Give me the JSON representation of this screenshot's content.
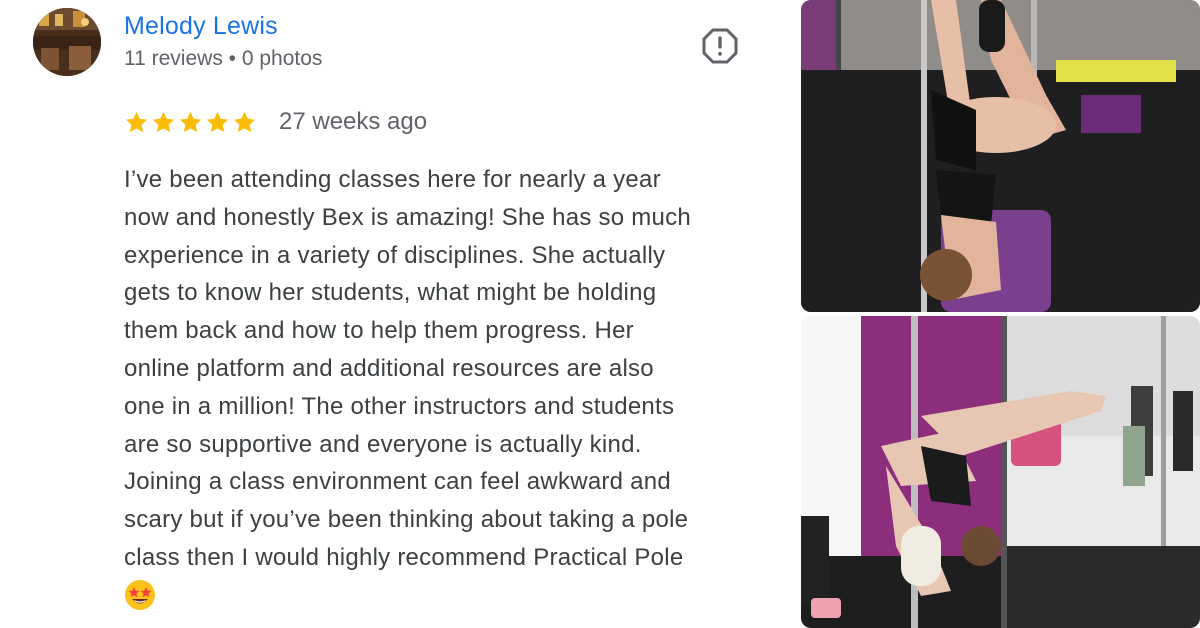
{
  "reviewer": {
    "name": "Melody Lewis",
    "meta": "11 reviews • 0 photos",
    "avatar_icon": "reviewer-avatar"
  },
  "review": {
    "rating": 5,
    "rating_max": 5,
    "time_ago": "27 weeks ago",
    "lines": [
      "I’ve been attending classes here for nearly a year",
      "now and honestly Bex is amazing! She has so much",
      "experience in a variety of disciplines. She actually",
      "gets to know her students, what might be holding",
      "them back and how to help them progress. Her",
      "online platform and additional resources are also",
      "one in a million! The other instructors and students",
      "are so supportive and everyone is actually kind.",
      "Joining a class environment can feel awkward and",
      "scary but if you’ve been thinking about taking a pole",
      "class then I would highly recommend Practical Pole"
    ],
    "emoji": "star-struck-emoji",
    "report_icon": "report-icon"
  },
  "photos": [
    {
      "icon": "pole-dance-photo-1"
    },
    {
      "icon": "pole-dance-photo-2"
    }
  ],
  "colors": {
    "name": "#1a73e8",
    "star": "#fbbc04",
    "meta": "#5f6368",
    "text": "#3c4043"
  }
}
